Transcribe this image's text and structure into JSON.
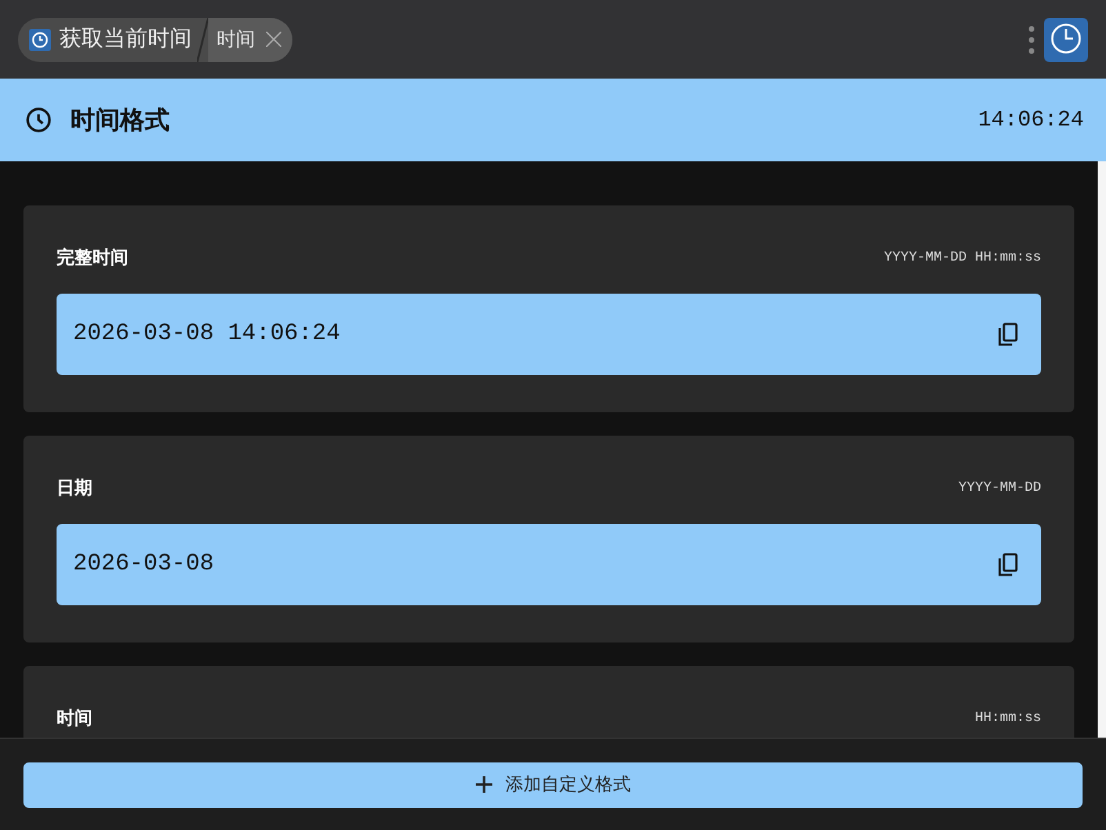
{
  "title_bar": {
    "breadcrumb": [
      {
        "label": "获取当前时间",
        "selected": false
      },
      {
        "label": "时间",
        "selected": true
      }
    ]
  },
  "header": {
    "title": "时间格式",
    "clock": "14:06:24"
  },
  "formats": [
    {
      "name": "完整时间",
      "pattern": "YYYY-MM-DD HH:mm:ss",
      "value": "2026-03-08 14:06:24"
    },
    {
      "name": "日期",
      "pattern": "YYYY-MM-DD",
      "value": "2026-03-08"
    },
    {
      "name": "时间",
      "pattern": "HH:mm:ss"
    }
  ],
  "footer": {
    "button": "添加自定义格式"
  }
}
